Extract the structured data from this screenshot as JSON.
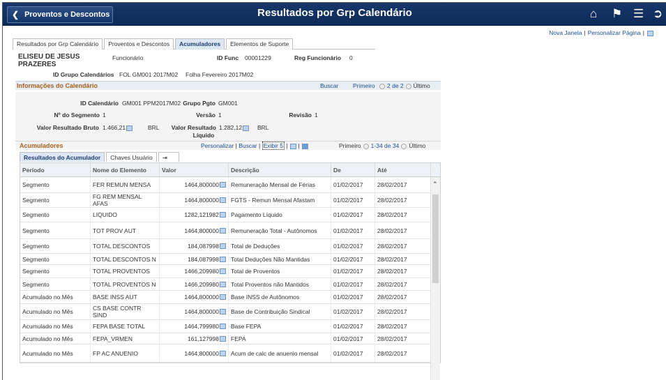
{
  "header": {
    "back_label": "Proventos e Descontos",
    "title": "Resultados por Grp Calendário"
  },
  "links": {
    "new_window": "Nova Janela",
    "personalize_page": "Personalizar Página"
  },
  "tabs": [
    {
      "label": "Resultados por Grp Calendário",
      "active": false
    },
    {
      "label": "Proventos e Descontos",
      "active": false
    },
    {
      "label": "Acumuladores",
      "active": true
    },
    {
      "label": "Elementos de Suporte",
      "active": false
    }
  ],
  "employee": {
    "name_line1": "ELISEU DE JESUS",
    "name_line2": "PRAZERES",
    "role": "Funcionário",
    "id_func_label": "ID Func",
    "id_func": "00001229",
    "reg_label": "Reg Funcionário",
    "reg": "0",
    "calendar_group_label": "ID Grupo Calendários",
    "calendar_group": "FOL GM001 2017M02",
    "calendar_group_desc": "Folha Fevereiro 2017M02"
  },
  "calendar_section": {
    "title": "Informações do Calendário",
    "search": "Buscar",
    "first": "Primeiro",
    "range": "2 de 2",
    "last": "Último",
    "id_calendar_label": "ID Calendário",
    "id_calendar": "GM001 PPM2017M02",
    "pay_group_label": "Grupo Pgto",
    "pay_group": "GM001",
    "segment_label": "Nº do Segmento",
    "segment": "1",
    "version_label": "Versão",
    "version": "1",
    "revision_label": "Revisão",
    "revision": "1",
    "gross_label": "Valor Resultado Bruto",
    "gross": "1.466,21",
    "gross_currency": "BRL",
    "net_label_1": "Valor Resultado",
    "net_label_2": "Líquido",
    "net": "1.282,12",
    "net_currency": "BRL"
  },
  "accumulators": {
    "title": "Acumuladores",
    "personalize": "Personalizar",
    "search": "Buscar",
    "show": "Exibir 5",
    "first": "Primeiro",
    "range": "1-34 de 34",
    "last": "Último",
    "subtabs": [
      "Resultados do Acumulador",
      "Chaves Usuário"
    ],
    "columns": [
      "Período",
      "Nome do Elemento",
      "Valor",
      "Descrição",
      "De",
      "Até"
    ],
    "rows": [
      {
        "periodo": "Segmento",
        "nome": "FER REMUN MENSA",
        "valor": "1464,800000",
        "descricao": "Remuneração Mensal de Férias",
        "de": "01/02/2017",
        "ate": "28/02/2017"
      },
      {
        "periodo": "Segmento",
        "nome": "FG REM MENSAL AFAS",
        "valor": "1464,800000",
        "descricao": "FGTS - Remun Mensal Afastam",
        "de": "01/02/2017",
        "ate": "28/02/2017"
      },
      {
        "periodo": "Segmento",
        "nome": "LIQUIDO",
        "valor": "1282,121982",
        "descricao": "Pagamento Líquido",
        "de": "01/02/2017",
        "ate": "28/02/2017"
      },
      {
        "periodo": "Segmento",
        "nome": "TOT PROV AUT",
        "valor": "1464,800000",
        "descricao": "Remuneração Total - Autônomos",
        "de": "01/02/2017",
        "ate": "28/02/2017"
      },
      {
        "periodo": "Segmento",
        "nome": "TOTAL DESCONTOS",
        "valor": "184,087998",
        "descricao": "Total de Deduções",
        "de": "01/02/2017",
        "ate": "28/02/2017"
      },
      {
        "periodo": "Segmento",
        "nome": "TOTAL DESCONTOS N",
        "valor": "184,087998",
        "descricao": "Total Deduções Não Mantidas",
        "de": "01/02/2017",
        "ate": "28/02/2017"
      },
      {
        "periodo": "Segmento",
        "nome": "TOTAL PROVENTOS",
        "valor": "1466,209980",
        "descricao": "Total de Proventos",
        "de": "01/02/2017",
        "ate": "28/02/2017"
      },
      {
        "periodo": "Segmento",
        "nome": "TOTAL PROVENTOS N",
        "valor": "1466,209980",
        "descricao": "Total Proventos não Mantidos",
        "de": "01/02/2017",
        "ate": "28/02/2017"
      },
      {
        "periodo": "Acumulado no Mês",
        "nome": "BASE INSS AUT",
        "valor": "1464,800000",
        "descricao": "Base INSS de Autônomos",
        "de": "01/02/2017",
        "ate": "28/02/2017"
      },
      {
        "periodo": "Acumulado no Mês",
        "nome": "CS BASE CONTR SIND",
        "valor": "1464,800000",
        "descricao": "Base de Contribuição Sindical",
        "de": "01/02/2017",
        "ate": "28/02/2017"
      },
      {
        "periodo": "Acumulado no Mês",
        "nome": "FEPA BASE TOTAL",
        "valor": "1464,799980",
        "descricao": "Base FEPA",
        "de": "01/02/2017",
        "ate": "28/02/2017"
      },
      {
        "periodo": "Acumulado no Mês",
        "nome": "FEPA_VRMEN",
        "valor": "161,127998",
        "descricao": "FEPA",
        "de": "01/02/2017",
        "ate": "28/02/2017"
      },
      {
        "periodo": "Acumulado no Mês",
        "nome": "FP AC ANUENIO",
        "valor": "1464,800000",
        "descricao": "Acum de calc de anuenio mensal",
        "de": "01/02/2017",
        "ate": "28/02/2017"
      }
    ]
  }
}
